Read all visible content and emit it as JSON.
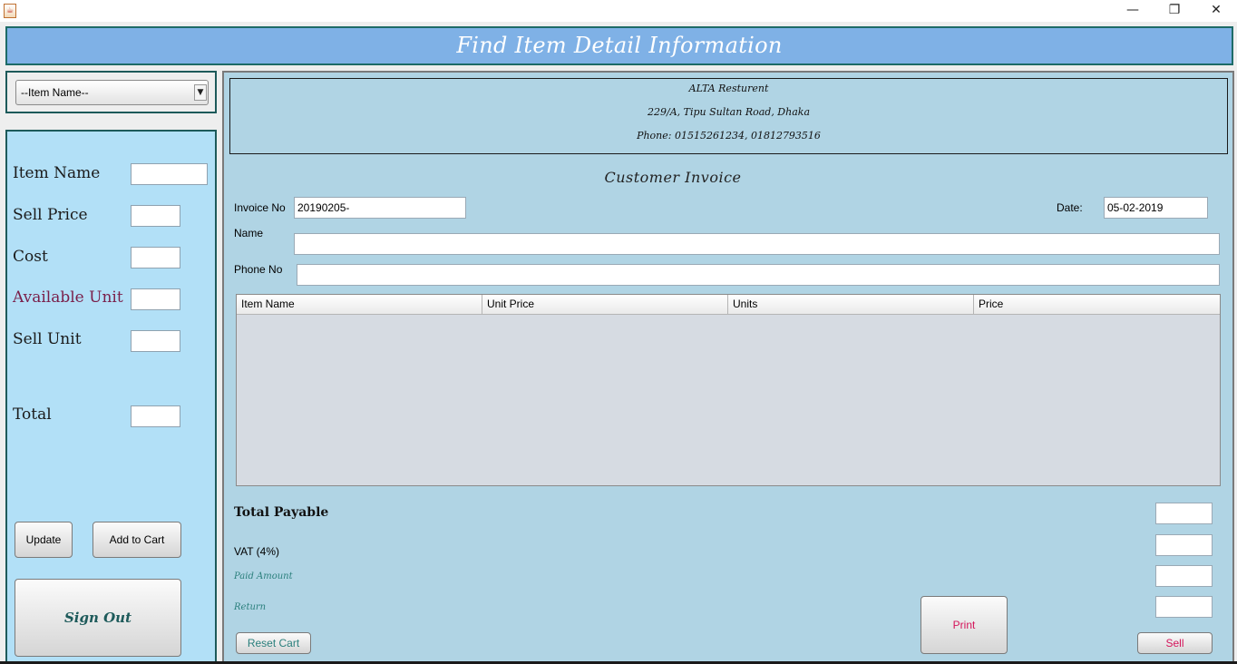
{
  "window": {
    "app_icon": "java-icon",
    "minimize": "—",
    "maximize": "❐",
    "close": "✕"
  },
  "header": {
    "title": "Find Item Detail Information"
  },
  "item_selector": {
    "selected": "--Item Name--",
    "arrow": "▼"
  },
  "left_panel": {
    "item_name_label": "Item Name",
    "sell_price_label": "Sell Price",
    "cost_label": "Cost",
    "available_unit_label": "Available Unit",
    "sell_unit_label": "Sell Unit",
    "total_label": "Total",
    "update_button": "Update",
    "add_to_cart_button": "Add to Cart",
    "sign_out_button": "Sign Out"
  },
  "restaurant": {
    "name": "ALTA  Resturent",
    "address": "229/A, Tipu Sultan Road, Dhaka",
    "phone": "Phone: 01515261234, 01812793516"
  },
  "invoice": {
    "title": "Customer  Invoice",
    "invoice_no_label": "Invoice No",
    "invoice_no_value": "20190205-",
    "date_label": "Date:",
    "date_value": "05-02-2019",
    "name_label": "Name",
    "phone_label": "Phone No",
    "columns": [
      "Item Name",
      "Unit Price",
      "Units",
      "Price"
    ],
    "total_payable_label": "Total Payable",
    "vat_label": "VAT (4%)",
    "paid_amount_label": "Paid Amount",
    "return_label": "Return",
    "reset_cart_button": "Reset Cart",
    "print_button": "Print",
    "sell_button": "Sell"
  },
  "colors": {
    "header_bg": "#7fb1e6",
    "left_panel_bg": "#b2e0f7",
    "main_panel_bg": "#b0d4e4",
    "accent_red": "#d4145a",
    "teal": "#2a7f7c"
  }
}
